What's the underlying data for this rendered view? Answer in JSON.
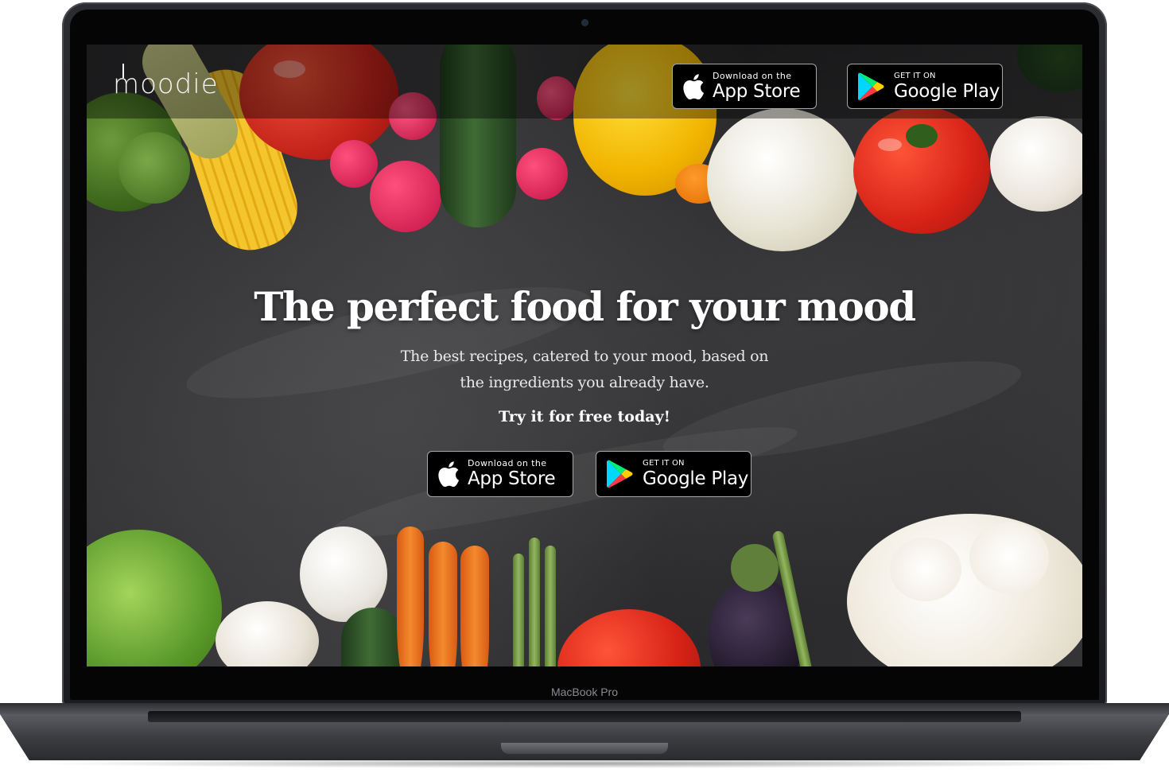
{
  "device": {
    "model_label": "MacBook Pro"
  },
  "header": {
    "logo_text": "moodie"
  },
  "badges": {
    "app_store": {
      "small": "Download on the",
      "big": "App Store",
      "icon": "apple-icon"
    },
    "google_play": {
      "small": "GET IT ON",
      "big": "Google Play",
      "icon": "google-play-icon"
    }
  },
  "hero": {
    "title": "The perfect food for your mood",
    "subtitle_line1": "The best recipes, catered to your mood, based on",
    "subtitle_line2": "the ingredients you already have.",
    "cta": "Try it for free today!"
  },
  "colors": {
    "background": "#2f2f31",
    "header_overlay": "rgba(0,0,0,0.38)",
    "badge_bg": "#000000",
    "badge_border": "#a6a6a6",
    "text": "#ffffff"
  }
}
